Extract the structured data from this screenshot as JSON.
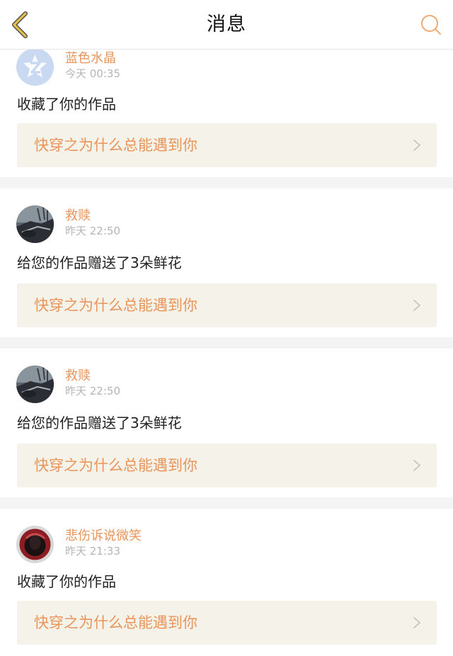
{
  "header": {
    "title": "消息",
    "back_icon": "chevron-left-icon",
    "search_icon": "search-icon",
    "accent_color": "#e0b33a"
  },
  "messages": [
    {
      "username": "蓝色水晶",
      "time": "今天 00:35",
      "action": "收藏了你的作品",
      "work_title": "快穿之为什么总能遇到你",
      "avatar": "default-avatar"
    },
    {
      "username": "救赎",
      "time": "昨天 22:50",
      "action": "给您的作品赠送了3朵鲜花",
      "work_title": "快穿之为什么总能遇到你",
      "avatar": "photo-avatar"
    },
    {
      "username": "救赎",
      "time": "昨天 22:50",
      "action": "给您的作品赠送了3朵鲜花",
      "work_title": "快穿之为什么总能遇到你",
      "avatar": "photo-avatar"
    },
    {
      "username": "悲伤诉说微笑",
      "time": "昨天 21:33",
      "action": "收藏了你的作品",
      "work_title": "快穿之为什么总能遇到你",
      "avatar": "photo-avatar"
    }
  ],
  "colors": {
    "username": "#e8955b",
    "work_title": "#e8955b",
    "work_box_bg": "#f4f2e9",
    "timestamp": "#b5b5b5"
  }
}
